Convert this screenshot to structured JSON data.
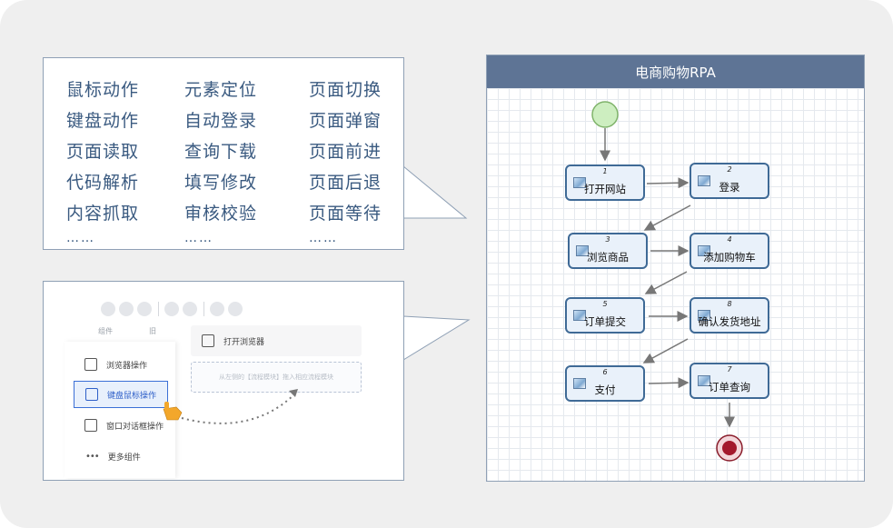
{
  "actions": {
    "col1": [
      "鼠标动作",
      "键盘动作",
      "页面读取",
      "代码解析",
      "内容抓取"
    ],
    "col2": [
      "元素定位",
      "自动登录",
      "查询下载",
      "填写修改",
      "审核校验"
    ],
    "col3": [
      "页面切换",
      "页面弹窗",
      "页面前进",
      "页面后退",
      "页面等待"
    ],
    "ellipsis": "……"
  },
  "designer": {
    "header_components": "组件",
    "header_other": "旧",
    "components": [
      {
        "label": "浏览器操作",
        "icon": "browser-icon"
      },
      {
        "label": "键盘鼠标操作",
        "icon": "mouse-keyboard-icon"
      },
      {
        "label": "窗口对话框操作",
        "icon": "window-dialog-icon"
      },
      {
        "label": "更多组件",
        "icon": "more-dots-icon"
      }
    ],
    "canvas_card": "打开浏览器",
    "dropzone_hint": "从左侧的【流程模块】拖入相应流程模块",
    "accent_color": "#3b6fd6"
  },
  "flow": {
    "title": "电商购物RPA",
    "header_color": "#5e7495",
    "nodes": [
      {
        "num": "1",
        "label": "打开网站"
      },
      {
        "num": "2",
        "label": "登录"
      },
      {
        "num": "3",
        "label": "浏览商品"
      },
      {
        "num": "4",
        "label": "添加购物车"
      },
      {
        "num": "5",
        "label": "订单提交"
      },
      {
        "num": "8",
        "label": "确认发货地址"
      },
      {
        "num": "6",
        "label": "支付"
      },
      {
        "num": "7",
        "label": "订单查询"
      }
    ]
  }
}
